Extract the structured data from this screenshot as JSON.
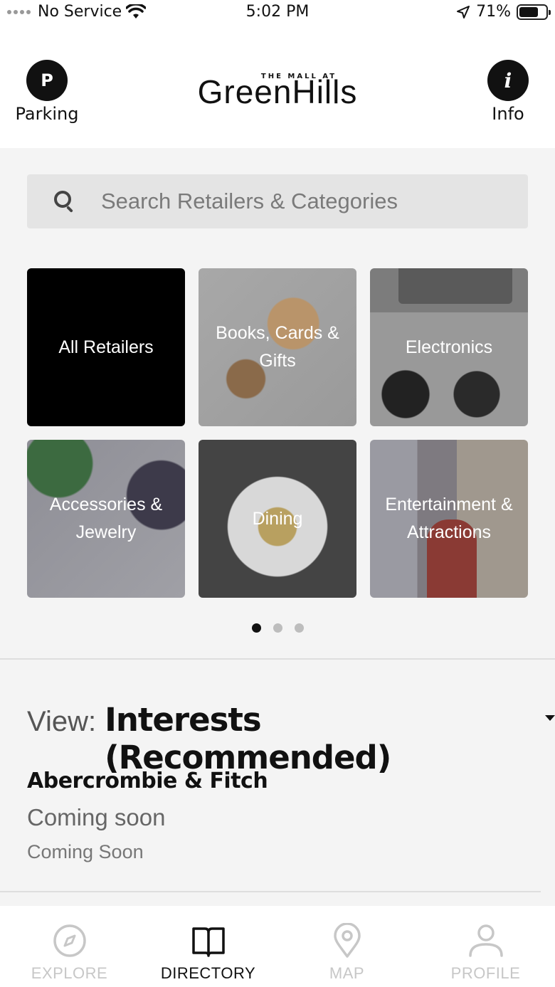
{
  "status_bar": {
    "carrier": "No Service",
    "time": "5:02 PM",
    "battery": "71%",
    "battery_level": 0.71
  },
  "header": {
    "parking_letter": "P",
    "parking_label": "Parking",
    "logo_small": "THE MALL AT",
    "logo_main": "GreenHills",
    "info_letter": "i",
    "info_label": "Info"
  },
  "search": {
    "placeholder": "Search Retailers & Categories"
  },
  "categories": [
    {
      "label": "All Retailers"
    },
    {
      "label": "Books, Cards & Gifts"
    },
    {
      "label": "Electronics"
    },
    {
      "label": "Accessories & Jewelry"
    },
    {
      "label": "Dining"
    },
    {
      "label": "Entertainment & Attractions"
    }
  ],
  "pagination": {
    "pages": 3,
    "active": 1
  },
  "view": {
    "label": "View:",
    "value": "Interests (Recommended)"
  },
  "store": {
    "name": "Abercrombie & Fitch",
    "status": "Coming soon",
    "sub": "Coming Soon"
  },
  "tabbar": {
    "explore": "EXPLORE",
    "directory": "DIRECTORY",
    "map": "MAP",
    "profile": "PROFILE"
  },
  "colors": {
    "accent": "#111111",
    "inactive_tab": "#c7c7c7",
    "background": "#f4f4f4"
  }
}
